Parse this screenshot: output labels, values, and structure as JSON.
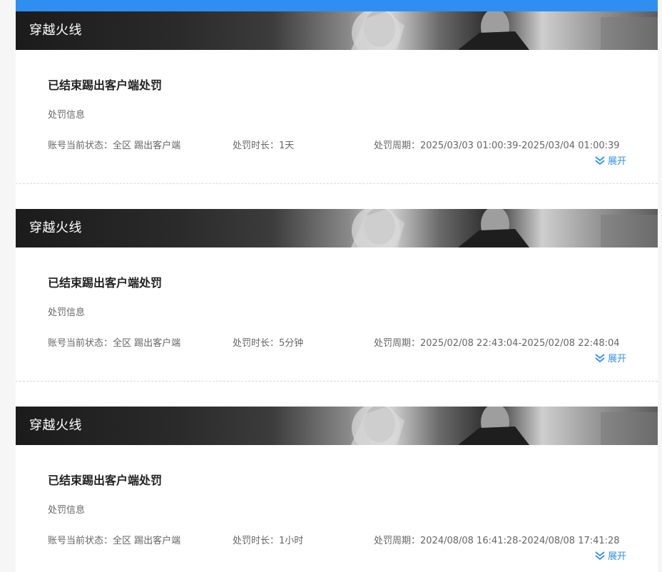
{
  "colors": {
    "accent": "#2f8ff0",
    "banner_text": "#ffffff",
    "title_text": "#222222",
    "meta_text": "#666666"
  },
  "records": [
    {
      "game": "穿越火线",
      "title": "已结束踢出客户端处罚",
      "section_label": "处罚信息",
      "status": "账号当前状态：全区 踢出客户端",
      "duration": "处罚时长：1天",
      "period": "处罚周期：2025/03/03 01:00:39-2025/03/04 01:00:39",
      "expand_label": "展开",
      "expand_icon": "double-chevron-down-icon"
    },
    {
      "game": "穿越火线",
      "title": "已结束踢出客户端处罚",
      "section_label": "处罚信息",
      "status": "账号当前状态：全区 踢出客户端",
      "duration": "处罚时长：5分钟",
      "period": "处罚周期：2025/02/08 22:43:04-2025/02/08 22:48:04",
      "expand_label": "展开",
      "expand_icon": "double-chevron-down-icon"
    },
    {
      "game": "穿越火线",
      "title": "已结束踢出客户端处罚",
      "section_label": "处罚信息",
      "status": "账号当前状态：全区 踢出客户端",
      "duration": "处罚时长：1小时",
      "period": "处罚周期：2024/08/08 16:41:28-2024/08/08 17:41:28",
      "expand_label": "展开",
      "expand_icon": "double-chevron-down-icon"
    }
  ]
}
